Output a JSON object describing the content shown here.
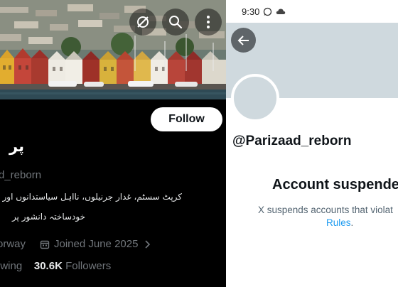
{
  "left_panel": {
    "follow_label": "Follow",
    "name": "پر",
    "handle": "d_reborn",
    "bio_line1": "کرپٹ سسٹم، غدار جرنیلوں، نااہل سیاستدانوں اور پٹواری",
    "bio_line2": "خودساختہ دانشور پر",
    "location": "orway",
    "joined": "Joined June 2025",
    "following_label": "owing",
    "followers_count": "30.6K",
    "followers_label": "Followers",
    "icons": [
      "grok-icon",
      "search-icon",
      "more-vertical-icon",
      "calendar-icon",
      "chevron-right-icon"
    ]
  },
  "right_panel": {
    "status_time": "9:30",
    "handle": "@Parizaad_reborn",
    "title": "Account suspende",
    "message": "X suspends accounts that violat",
    "rules_link": "Rules",
    "rules_after": ".",
    "icons": [
      "whatsapp-icon",
      "cloud-icon",
      "back-arrow-icon"
    ]
  },
  "colors": {
    "left_bg": "#000000",
    "muted_text": "#71767b",
    "banner_placeholder": "#cfd9de",
    "link": "#1d9bf0",
    "right_muted": "#536471"
  }
}
